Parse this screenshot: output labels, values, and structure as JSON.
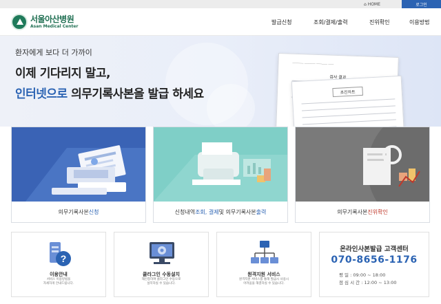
{
  "topbar": {
    "home_label": "HOME",
    "login_label": "로그인"
  },
  "logo": {
    "name_ko": "서울아산병원",
    "name_en": "Asan Medical Center"
  },
  "gnb": [
    "발급신청",
    "조회/결제/출력",
    "진위확인",
    "이용방법"
  ],
  "hero": {
    "subtitle": "환자에게 보다 더 가까이",
    "line1": "이제 기다리지 말고,",
    "line2_highlight": "인터넷으로",
    "line2_rest": " 의무기록사본을 발급 하세요",
    "doc_back_title": "검사 결과",
    "doc_front_title": "초진차트"
  },
  "cards": [
    {
      "pre": "의무기록사본 ",
      "hl": "신청",
      "post": ""
    },
    {
      "pre": "신청내역 ",
      "hl": "조회, 결제",
      "post": " 및 의무기록사본 ",
      "hl2": "출력"
    },
    {
      "pre": "의무기록사본 ",
      "hl": "진위확인",
      "post": ""
    }
  ],
  "info_boxes": [
    {
      "title": "이용안내",
      "desc1": "서비스 이용방법을",
      "desc2": "자세하게 안내드립니다."
    },
    {
      "title": "클라그인 수동설치",
      "desc1": "재신청하여 클라그인 수동으로",
      "desc2": "설치하실 수 있습니다."
    },
    {
      "title": "원격지원 서비스",
      "desc1": "원격지원 서비스를 통해 발급시 사용시",
      "desc2": "어려움을 해결하실 수 있습니다."
    }
  ],
  "customer_center": {
    "title": "온라인사본발급 고객센터",
    "phone": "070-8656-1176",
    "weekday_label": "평      일",
    "weekday_hours": ": 09:00 ~ 18:00",
    "lunch_label": "점 심 시 간",
    "lunch_hours": ": 12:00 ~ 13:00"
  },
  "colors": {
    "brand_green": "#1f6f52",
    "accent_blue": "#2b63b3",
    "card1_bg": "#3a63b5",
    "card2_bg": "#7fcfc7",
    "card3_bg": "#7a7a7a"
  },
  "icons": [
    "home-icon",
    "hospital-emblem-icon",
    "help-icon",
    "settings-monitor-icon",
    "network-icon"
  ]
}
